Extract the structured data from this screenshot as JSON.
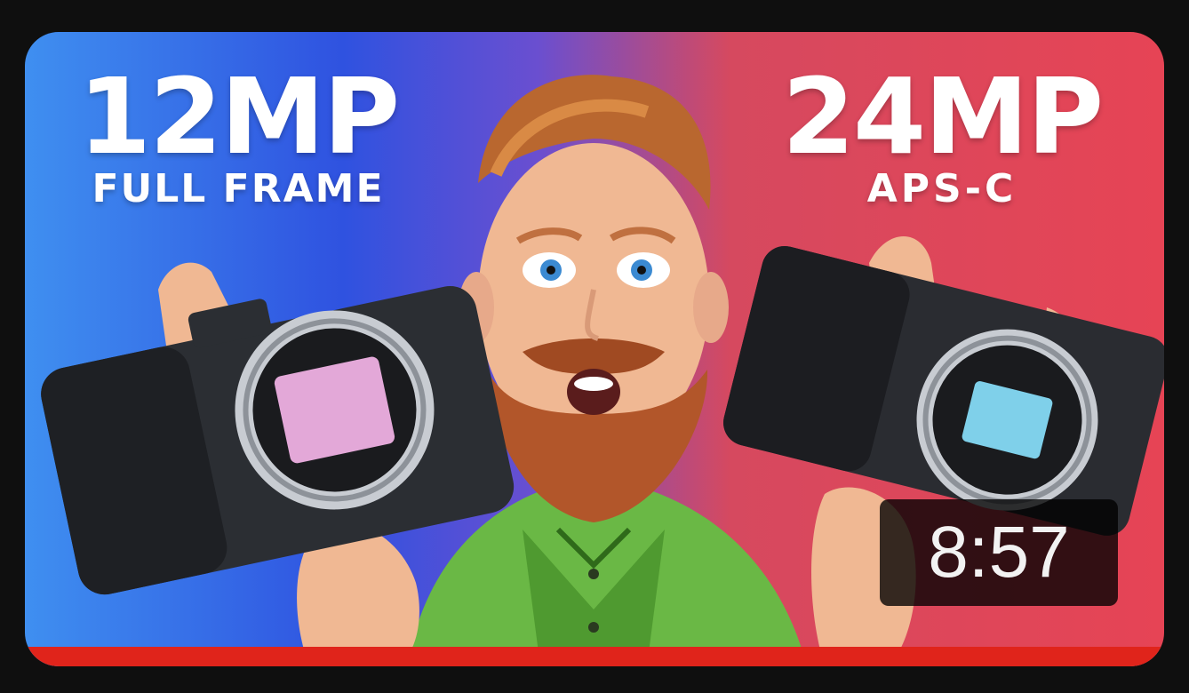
{
  "video": {
    "left_label": {
      "title": "12MP",
      "subtitle": "FULL FRAME"
    },
    "right_label": {
      "title": "24MP",
      "subtitle": "APS-C"
    },
    "duration": "8:57",
    "watch_progress_fraction": 1.0
  },
  "colors": {
    "left_bg": "#2f52e0",
    "right_bg": "#e64455",
    "progress": "#e0241b"
  }
}
